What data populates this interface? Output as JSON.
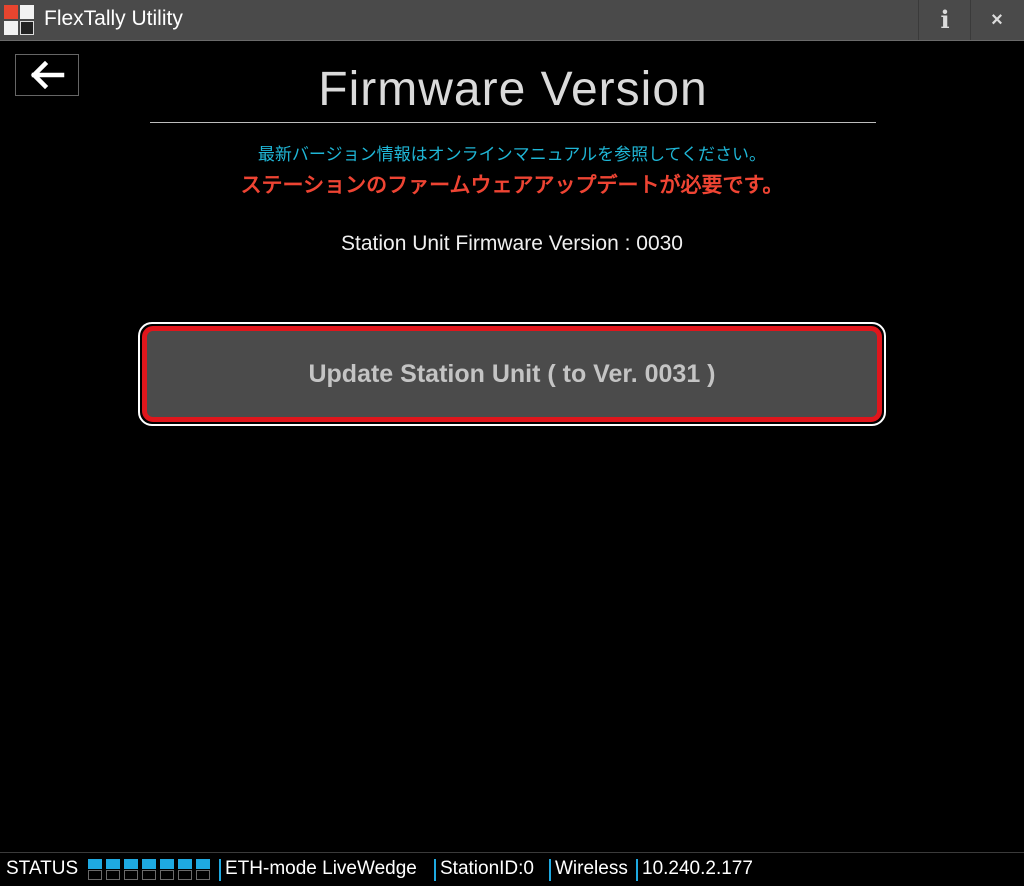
{
  "window": {
    "title": "FlexTally Utility",
    "info_button": "i",
    "close_button": "×"
  },
  "page": {
    "title": "Firmware Version",
    "info_text": "最新バージョン情報はオンラインマニュアルを参照してください。",
    "warning_text": "ステーションのファームウェアアップデートが必要です。",
    "version_text": "Station Unit Firmware Version : 0030",
    "update_button": "Update Station Unit ( to Ver. 0031 )"
  },
  "statusbar": {
    "label": "STATUS",
    "level_filled": 7,
    "level_total": 7,
    "mode": "ETH-mode LiveWedge",
    "station_id": "StationID:0",
    "link": "Wireless",
    "ip": "10.240.2.177"
  },
  "colors": {
    "accent": "#1ea9e1",
    "warning": "#ee4433",
    "info": "#1fb6d6",
    "button_border": "#e0161c"
  }
}
